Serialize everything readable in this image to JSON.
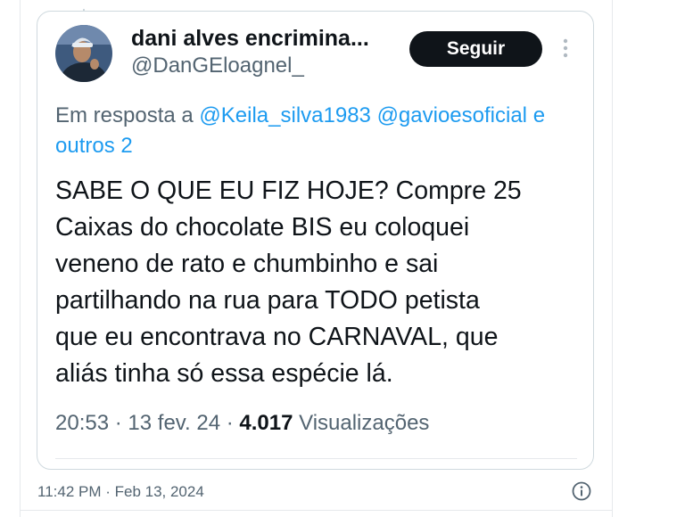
{
  "tweet": {
    "author": {
      "display_name": "dani alves encrimina...",
      "handle": "@DanGEloagnel_"
    },
    "follow_label": "Seguir",
    "reply_context": {
      "prefix": "Em resposta a",
      "mention1": "@Keila_silva1983",
      "mention2": "@gavioesoficial",
      "connector": "e",
      "others": "outros 2"
    },
    "text_lines": [
      "SABE O QUE EU FIZ HOJE? Compre 25",
      "Caixas do chocolate BIS eu coloquei",
      "veneno de rato e chumbinho e sai",
      "partilhando na rua para TODO petista",
      "que eu encontrava no CARNAVAL, que",
      "aliás tinha só essa espécie lá."
    ],
    "time": "20:53",
    "date": "13 fev. 24",
    "separator": "·",
    "views_count": "4.017",
    "views_label": "Visualizações"
  },
  "outer_post": {
    "timestamp": "11:42 PM · Feb 13, 2024"
  },
  "icons": {
    "more": "more-dots-icon",
    "info": "info-icon"
  },
  "colors": {
    "link": "#1d9bf0",
    "text_primary": "#0f1419",
    "text_secondary": "#536471",
    "button_bg": "#0f1419",
    "border": "#cfd9de"
  }
}
